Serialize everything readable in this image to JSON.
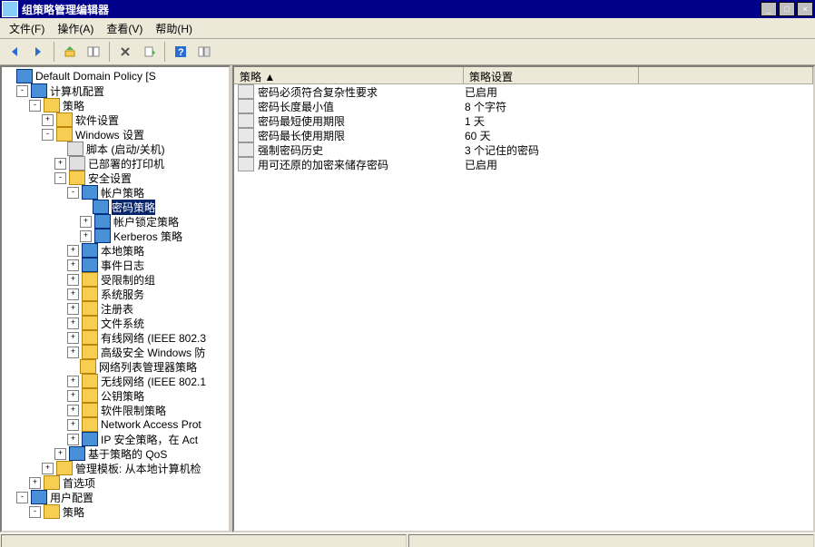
{
  "window": {
    "title": "组策略管理编辑器",
    "buttons": {
      "min": "_",
      "max": "□",
      "close": "×"
    }
  },
  "menu": {
    "file": "文件(F)",
    "action": "操作(A)",
    "view": "查看(V)",
    "help": "帮助(H)"
  },
  "tree": [
    {
      "d": 0,
      "exp": "",
      "icon": "cfg",
      "label": "Default Domain Policy [S"
    },
    {
      "d": 1,
      "exp": "-",
      "icon": "cfg",
      "label": "计算机配置"
    },
    {
      "d": 2,
      "exp": "-",
      "icon": "folder",
      "label": "策略"
    },
    {
      "d": 3,
      "exp": "+",
      "icon": "folder",
      "label": "软件设置"
    },
    {
      "d": 3,
      "exp": "-",
      "icon": "folder",
      "label": "Windows 设置"
    },
    {
      "d": 4,
      "exp": "",
      "icon": "scr",
      "label": "脚本 (启动/关机)"
    },
    {
      "d": 4,
      "exp": "+",
      "icon": "scr",
      "label": "已部署的打印机"
    },
    {
      "d": 4,
      "exp": "-",
      "icon": "folder",
      "label": "安全设置"
    },
    {
      "d": 5,
      "exp": "-",
      "icon": "cfg",
      "label": "帐户策略"
    },
    {
      "d": 6,
      "exp": "",
      "icon": "cfg",
      "label": "密码策略",
      "sel": true
    },
    {
      "d": 6,
      "exp": "+",
      "icon": "cfg",
      "label": "帐户锁定策略"
    },
    {
      "d": 6,
      "exp": "+",
      "icon": "cfg",
      "label": "Kerberos 策略"
    },
    {
      "d": 5,
      "exp": "+",
      "icon": "cfg",
      "label": "本地策略"
    },
    {
      "d": 5,
      "exp": "+",
      "icon": "cfg",
      "label": "事件日志"
    },
    {
      "d": 5,
      "exp": "+",
      "icon": "folder",
      "label": "受限制的组"
    },
    {
      "d": 5,
      "exp": "+",
      "icon": "folder",
      "label": "系统服务"
    },
    {
      "d": 5,
      "exp": "+",
      "icon": "folder",
      "label": "注册表"
    },
    {
      "d": 5,
      "exp": "+",
      "icon": "folder",
      "label": "文件系统"
    },
    {
      "d": 5,
      "exp": "+",
      "icon": "folder",
      "label": "有线网络 (IEEE 802.3"
    },
    {
      "d": 5,
      "exp": "+",
      "icon": "folder",
      "label": "高级安全 Windows 防"
    },
    {
      "d": 5,
      "exp": "",
      "icon": "folder",
      "label": "网络列表管理器策略"
    },
    {
      "d": 5,
      "exp": "+",
      "icon": "folder",
      "label": "无线网络 (IEEE 802.1"
    },
    {
      "d": 5,
      "exp": "+",
      "icon": "folder",
      "label": "公钥策略"
    },
    {
      "d": 5,
      "exp": "+",
      "icon": "folder",
      "label": "软件限制策略"
    },
    {
      "d": 5,
      "exp": "+",
      "icon": "folder",
      "label": "Network Access Prot"
    },
    {
      "d": 5,
      "exp": "+",
      "icon": "cfg",
      "label": "IP 安全策略，在 Act"
    },
    {
      "d": 4,
      "exp": "+",
      "icon": "cfg",
      "label": "基于策略的 QoS"
    },
    {
      "d": 3,
      "exp": "+",
      "icon": "folder",
      "label": "管理模板: 从本地计算机检"
    },
    {
      "d": 2,
      "exp": "+",
      "icon": "folder",
      "label": "首选项"
    },
    {
      "d": 1,
      "exp": "-",
      "icon": "cfg",
      "label": "用户配置"
    },
    {
      "d": 2,
      "exp": "-",
      "icon": "folder",
      "label": "策略"
    }
  ],
  "list": {
    "headers": {
      "policy": "策略  ▲",
      "setting": "策略设置"
    },
    "rows": [
      {
        "policy": "密码必须符合复杂性要求",
        "setting": "已启用"
      },
      {
        "policy": "密码长度最小值",
        "setting": "8 个字符"
      },
      {
        "policy": "密码最短使用期限",
        "setting": "1 天"
      },
      {
        "policy": "密码最长使用期限",
        "setting": "60 天"
      },
      {
        "policy": "强制密码历史",
        "setting": "3 个记住的密码"
      },
      {
        "policy": "用可还原的加密来储存密码",
        "setting": "已启用"
      }
    ]
  }
}
